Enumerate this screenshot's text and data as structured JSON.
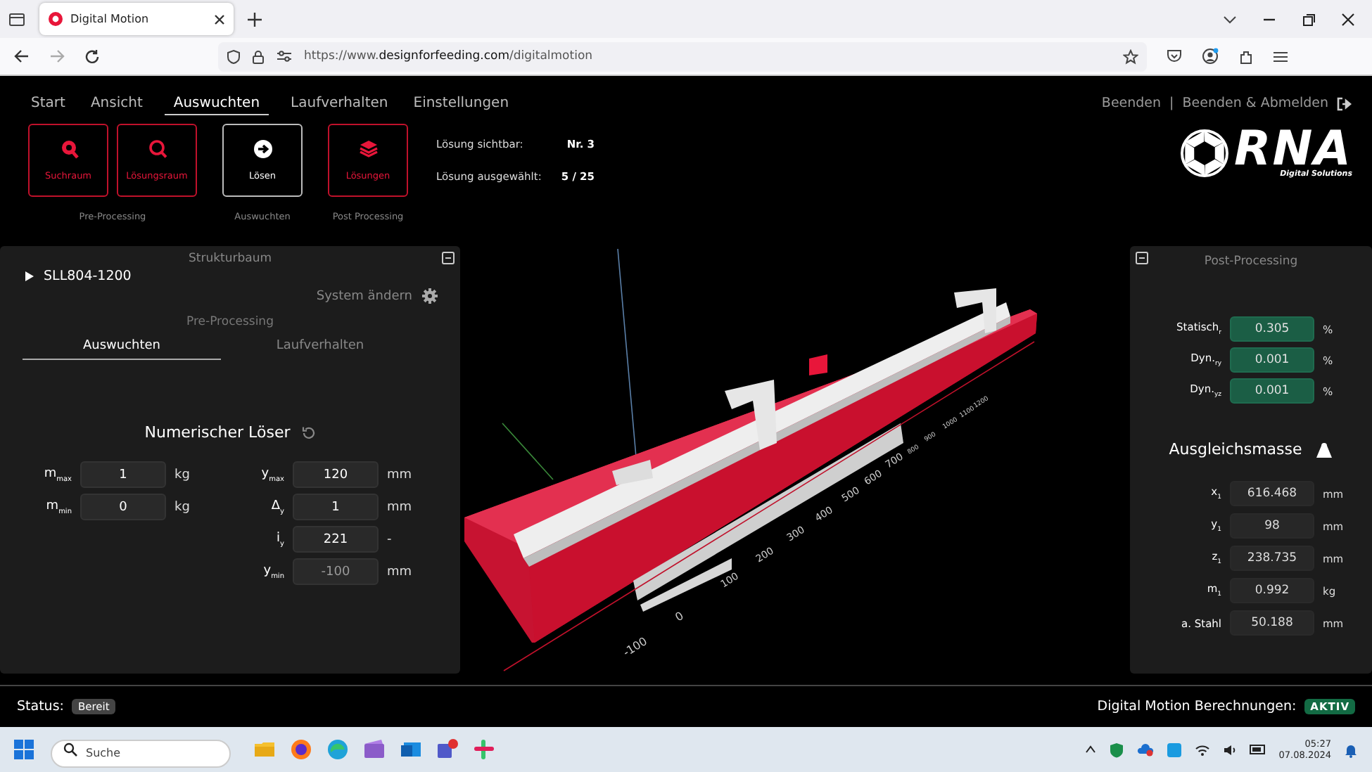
{
  "browser": {
    "tab_title": "Digital Motion",
    "url_prefix": "https://www.",
    "url_domain": "designforfeeding.com",
    "url_path": "/digitalmotion"
  },
  "nav": {
    "tabs": [
      {
        "label": "Start",
        "selected": false
      },
      {
        "label": "Ansicht",
        "selected": false
      },
      {
        "label": "Auswuchten",
        "selected": true
      },
      {
        "label": "Laufverhalten",
        "selected": false
      },
      {
        "label": "Einstellungen",
        "selected": false
      }
    ],
    "links": [
      "Beenden",
      "Beenden & Abmelden"
    ],
    "separator": "|"
  },
  "toolbar": [
    {
      "caption": "Pre-Processing",
      "buttons": [
        {
          "label": "Suchraum",
          "kind": "search-pin",
          "highlighted": false
        },
        {
          "label": "Lösungsraum",
          "kind": "search",
          "highlighted": false
        }
      ]
    },
    {
      "caption": "Auswuchten",
      "buttons": [
        {
          "label": "Lösen",
          "kind": "run",
          "highlighted": true
        }
      ]
    },
    {
      "caption": "Post Processing",
      "buttons": [
        {
          "label": "Lösungen",
          "kind": "layers",
          "highlighted": false
        }
      ]
    }
  ],
  "solution_info": [
    {
      "label": "Lösung sichtbar:",
      "value": "Nr. 3"
    },
    {
      "label": "Lösung ausgewählt:",
      "value": "5 / 25"
    }
  ],
  "logo": {
    "name": "RNA",
    "tagline": "Digital Solutions"
  },
  "left_panel": {
    "title": "Strukturbaum",
    "tree": [
      {
        "label": "SLL804-1200",
        "expanded": false
      }
    ],
    "system_link": "System ändern",
    "section_title": "Pre-Processing",
    "tabs": [
      {
        "label": "Auswuchten",
        "selected": true
      },
      {
        "label": "Laufverhalten",
        "selected": false
      }
    ],
    "solver_title": "Numerischer Löser",
    "left_fields": [
      {
        "label": "m$_{max}$",
        "value": "1",
        "unit": "kg",
        "disabled": false
      },
      {
        "label": "m$_{min}$",
        "value": "0",
        "unit": "kg",
        "disabled": false
      }
    ],
    "right_fields": [
      {
        "label": "y$_{max}$",
        "value": "120",
        "unit": "mm",
        "disabled": false
      },
      {
        "label": "Δ$_{y}$",
        "value": "1",
        "unit": "mm",
        "disabled": false
      },
      {
        "label": "i$_{y}$",
        "value": "221",
        "unit": "-",
        "disabled": false
      },
      {
        "label": "y$_{min}$",
        "value": "-100",
        "unit": "mm",
        "disabled": true
      }
    ]
  },
  "viewport": {
    "axis_labels": [
      "-100",
      "0",
      "100",
      "200",
      "300",
      "400",
      "500",
      "600",
      "700",
      "800",
      "900",
      "1000",
      "1100",
      "1200"
    ]
  },
  "right_panel": {
    "title": "Post-Processing",
    "balance": [
      {
        "label": "Statisch$_{r}$",
        "value": "0.305",
        "unit": "%"
      },
      {
        "label": "Dyn.$_{ry}$",
        "value": "0.001",
        "unit": "%"
      },
      {
        "label": "Dyn.$_{yz}$",
        "value": "0.001",
        "unit": "%"
      }
    ],
    "mass_title": "Ausgleichsmasse",
    "mass_fields": [
      {
        "label": "x$_{1}$",
        "value": "616.468",
        "unit": "mm"
      },
      {
        "label": "y$_{1}$",
        "value": "98",
        "unit": "mm"
      },
      {
        "label": "z$_{1}$",
        "value": "238.735",
        "unit": "mm"
      },
      {
        "label": "m$_{1}$",
        "value": "0.992",
        "unit": "kg"
      },
      {
        "label": "a. Stahl",
        "value": "50.188",
        "unit": "mm"
      }
    ]
  },
  "status": {
    "label": "Status:",
    "value": "Bereit",
    "calc_label": "Digital Motion Berechnungen:",
    "calc_value": "AKTIV",
    "active": true
  },
  "taskbar": {
    "search_placeholder": "Suche",
    "time": "05:27",
    "date": "07.08.2024"
  }
}
